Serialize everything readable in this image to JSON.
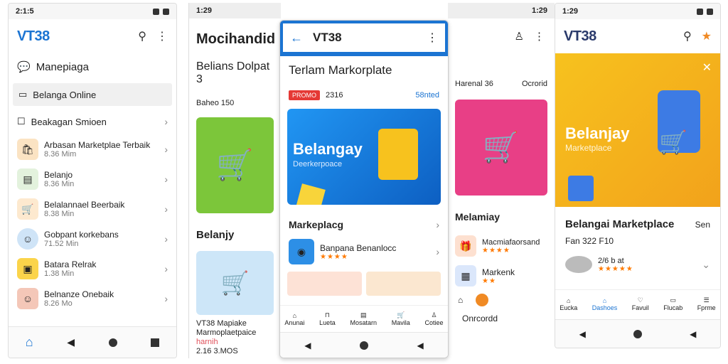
{
  "status": {
    "time_1": "2:1:5",
    "time_2": "1:29",
    "time_3": "1:29",
    "time_4": "1:29"
  },
  "phone1": {
    "logo": "VT38",
    "menu_title": "Manepiaga",
    "active_item": "Belanga Online",
    "section": "Beakagan Smioen",
    "items": [
      {
        "title": "Arbasan Marketplae Terbaik",
        "sub": "8.36 Mim"
      },
      {
        "title": "Belanjo",
        "sub": "8.36 Min"
      },
      {
        "title": "Belalannael Beerbaik",
        "sub": "8.38 Min"
      },
      {
        "title": "Gobpant korkebans",
        "sub": "71.52 Min"
      },
      {
        "title": "Batara Relrak",
        "sub": "1.38 Min"
      },
      {
        "title": "Belnanze Onebaik",
        "sub": "8.26 Mo"
      }
    ]
  },
  "phone2": {
    "heading": "Mocihandid",
    "sub": "Belians Dolpat 3",
    "count": "Baheo 150",
    "section": "Belanjy",
    "footer_title": "VT38 Mapiake",
    "footer_sub": "Marmoplaetpaice",
    "footer_link": "harnih",
    "footer_size": "2.16 3.MOS"
  },
  "phone3": {
    "back": "←",
    "title": "VT38",
    "heading": "Terlam Markorplate",
    "badge": "PROMO",
    "badge_num": "2316",
    "link": "58nted",
    "banner_title": "Belangay",
    "banner_sub": "Deerkerpoace",
    "section": "Markeplacg",
    "item_title": "Banpana Benanlocc",
    "nav": [
      "Anunai",
      "Lueta",
      "Mosatarn",
      "Mavila",
      "Cotiee"
    ]
  },
  "phone4": {
    "label1": "Harenal 36",
    "label2": "Ocrorid",
    "section": "Melamiay",
    "item1": "Macmiafaorsand",
    "item2": "Markenk",
    "footer": "Onrcordd"
  },
  "phone5": {
    "logo": "VT38",
    "banner_title": "Belanjay",
    "banner_sub": "Marketplace",
    "heading": "Belangai Marketplace",
    "heading_side": "Sen",
    "price": "Fan 322 F10",
    "rating": "2/6 b at",
    "nav": [
      "Eucka",
      "Dashoes",
      "Favuil",
      "Flucab",
      "Fprme"
    ]
  },
  "colors": {
    "brand": "#1b74d2",
    "accent": "#f2a21b",
    "green": "#7cc63a",
    "pink": "#e83f86"
  }
}
